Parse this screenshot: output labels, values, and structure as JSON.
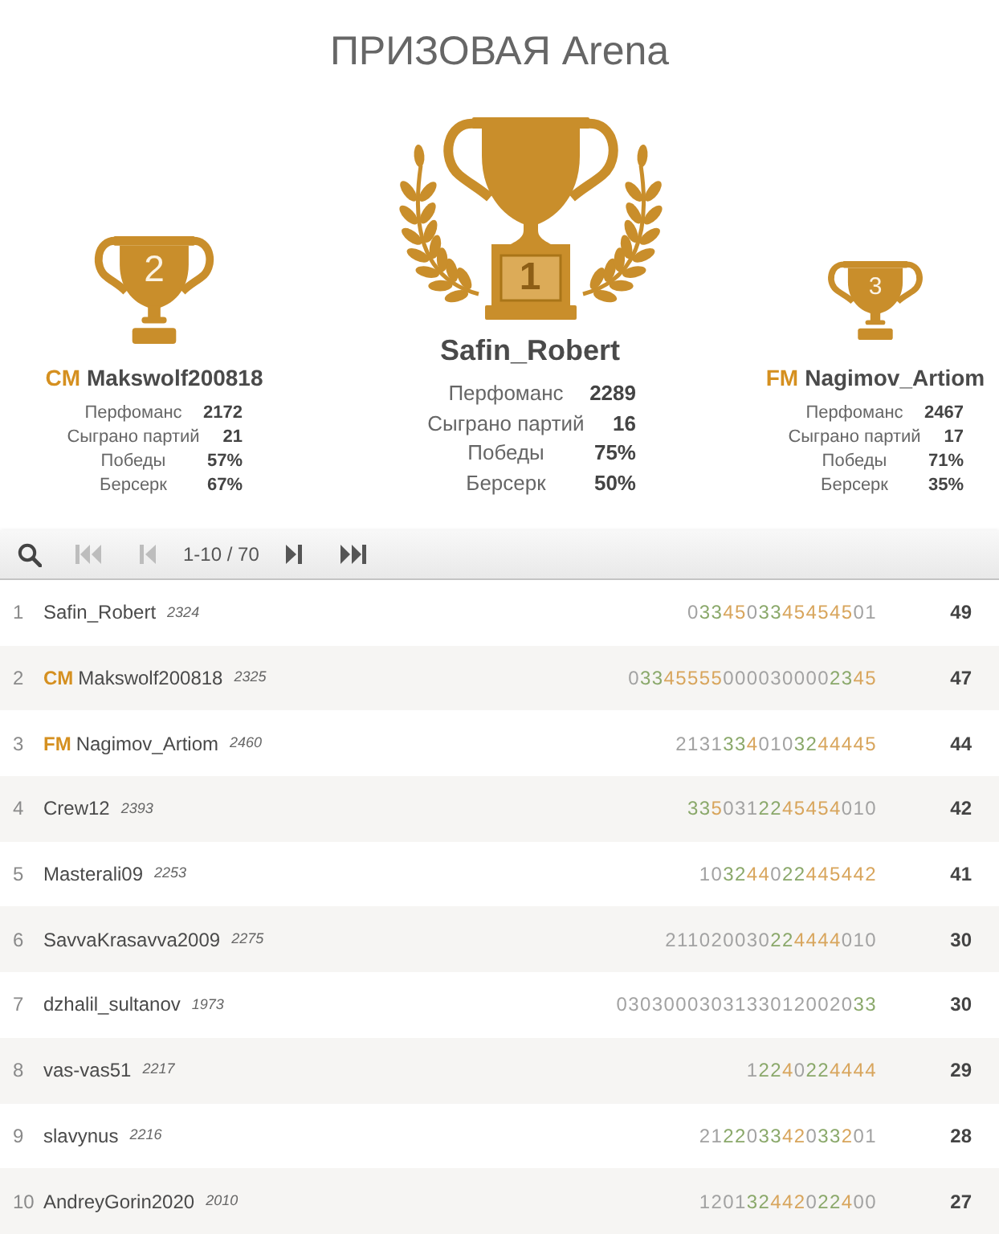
{
  "title": "ПРИЗОВАЯ Arena",
  "podium": [
    {
      "kind": "second",
      "place": "2",
      "title": "CM",
      "name": "Makswolf200818",
      "stats": [
        {
          "label": "Перфоманс",
          "value": "2172"
        },
        {
          "label": "Сыграно партий",
          "value": "21"
        },
        {
          "label": "Победы",
          "value": "57%"
        },
        {
          "label": "Берсерк",
          "value": "67%"
        }
      ]
    },
    {
      "kind": "first",
      "place": "1",
      "name": "Safin_Robert",
      "stats": [
        {
          "label": "Перфоманс",
          "value": "2289"
        },
        {
          "label": "Сыграно партий",
          "value": "16"
        },
        {
          "label": "Победы",
          "value": "75%"
        },
        {
          "label": "Берсерк",
          "value": "50%"
        }
      ]
    },
    {
      "kind": "third",
      "place": "3",
      "title": "FM",
      "name": "Nagimov_Artiom",
      "stats": [
        {
          "label": "Перфоманс",
          "value": "2467"
        },
        {
          "label": "Сыграно партий",
          "value": "17"
        },
        {
          "label": "Победы",
          "value": "71%"
        },
        {
          "label": "Берсерк",
          "value": "35%"
        }
      ]
    }
  ],
  "toolbar": {
    "pager_before": [
      {
        "kind": "first",
        "disabled": true
      },
      {
        "kind": "prev",
        "disabled": true
      }
    ],
    "page_info": "1-10 / 70",
    "pager_after": [
      {
        "kind": "next",
        "disabled": false
      },
      {
        "kind": "last",
        "disabled": false
      }
    ]
  },
  "rows": [
    {
      "rank": "1",
      "name": "Safin_Robert",
      "rating": "2324",
      "score": [
        {
          "digits": "0",
          "kind": "plain"
        },
        {
          "digits": "33",
          "kind": "streak_start"
        },
        {
          "digits": "45",
          "kind": "double"
        },
        {
          "digits": "0",
          "kind": "plain"
        },
        {
          "digits": "33",
          "kind": "streak_start"
        },
        {
          "digits": "454545",
          "kind": "double"
        },
        {
          "digits": "01",
          "kind": "plain"
        }
      ],
      "total": "49"
    },
    {
      "rank": "2",
      "title": "CM",
      "name": "Makswolf200818",
      "rating": "2325",
      "score": [
        {
          "digits": "0",
          "kind": "plain"
        },
        {
          "digits": "33",
          "kind": "streak_start"
        },
        {
          "digits": "45555",
          "kind": "double"
        },
        {
          "digits": "000030000",
          "kind": "plain"
        },
        {
          "digits": "23",
          "kind": "streak_start"
        },
        {
          "digits": "45",
          "kind": "double"
        }
      ],
      "total": "47"
    },
    {
      "rank": "3",
      "title": "FM",
      "name": "Nagimov_Artiom",
      "rating": "2460",
      "score": [
        {
          "digits": "2131",
          "kind": "plain"
        },
        {
          "digits": "33",
          "kind": "streak_start"
        },
        {
          "digits": "4",
          "kind": "double"
        },
        {
          "digits": "010",
          "kind": "plain"
        },
        {
          "digits": "32",
          "kind": "streak_start"
        },
        {
          "digits": "44445",
          "kind": "double"
        }
      ],
      "total": "44"
    },
    {
      "rank": "4",
      "name": "Crew12",
      "rating": "2393",
      "score": [
        {
          "digits": "33",
          "kind": "streak_start"
        },
        {
          "digits": "5",
          "kind": "double"
        },
        {
          "digits": "031",
          "kind": "plain"
        },
        {
          "digits": "22",
          "kind": "streak_start"
        },
        {
          "digits": "45454",
          "kind": "double"
        },
        {
          "digits": "010",
          "kind": "plain"
        }
      ],
      "total": "42"
    },
    {
      "rank": "5",
      "name": "Masterali09",
      "rating": "2253",
      "score": [
        {
          "digits": "10",
          "kind": "plain"
        },
        {
          "digits": "32",
          "kind": "streak_start"
        },
        {
          "digits": "44",
          "kind": "double"
        },
        {
          "digits": "0",
          "kind": "plain"
        },
        {
          "digits": "22",
          "kind": "streak_start"
        },
        {
          "digits": "445442",
          "kind": "double"
        }
      ],
      "total": "41"
    },
    {
      "rank": "6",
      "name": "SavvaKrasavva2009",
      "rating": "2275",
      "score": [
        {
          "digits": "211020030",
          "kind": "plain"
        },
        {
          "digits": "22",
          "kind": "streak_start"
        },
        {
          "digits": "4444",
          "kind": "double"
        },
        {
          "digits": "010",
          "kind": "plain"
        }
      ],
      "total": "30"
    },
    {
      "rank": "7",
      "name": "dzhalil_sultanov",
      "rating": "1973",
      "score": [
        {
          "digits": "03030003031330120020",
          "kind": "plain"
        },
        {
          "digits": "33",
          "kind": "streak_start"
        }
      ],
      "total": "30"
    },
    {
      "rank": "8",
      "name": "vas-vas51",
      "rating": "2217",
      "score": [
        {
          "digits": "1",
          "kind": "plain"
        },
        {
          "digits": "22",
          "kind": "streak_start"
        },
        {
          "digits": "4",
          "kind": "double"
        },
        {
          "digits": "0",
          "kind": "plain"
        },
        {
          "digits": "22",
          "kind": "streak_start"
        },
        {
          "digits": "4444",
          "kind": "double"
        }
      ],
      "total": "29"
    },
    {
      "rank": "9",
      "name": "slavynus",
      "rating": "2216",
      "score": [
        {
          "digits": "21",
          "kind": "plain"
        },
        {
          "digits": "22",
          "kind": "streak_start"
        },
        {
          "digits": "0",
          "kind": "plain"
        },
        {
          "digits": "33",
          "kind": "streak_start"
        },
        {
          "digits": "42",
          "kind": "double"
        },
        {
          "digits": "0",
          "kind": "plain"
        },
        {
          "digits": "33",
          "kind": "streak_start"
        },
        {
          "digits": "2",
          "kind": "double"
        },
        {
          "digits": "01",
          "kind": "plain"
        }
      ],
      "total": "28"
    },
    {
      "rank": "10",
      "name": "AndreyGorin2020",
      "rating": "2010",
      "score": [
        {
          "digits": "1201",
          "kind": "plain"
        },
        {
          "digits": "32",
          "kind": "streak_start"
        },
        {
          "digits": "442",
          "kind": "double"
        },
        {
          "digits": "0",
          "kind": "plain"
        },
        {
          "digits": "22",
          "kind": "streak_start"
        },
        {
          "digits": "4",
          "kind": "double"
        },
        {
          "digits": "00",
          "kind": "plain"
        }
      ],
      "total": "27"
    }
  ]
}
